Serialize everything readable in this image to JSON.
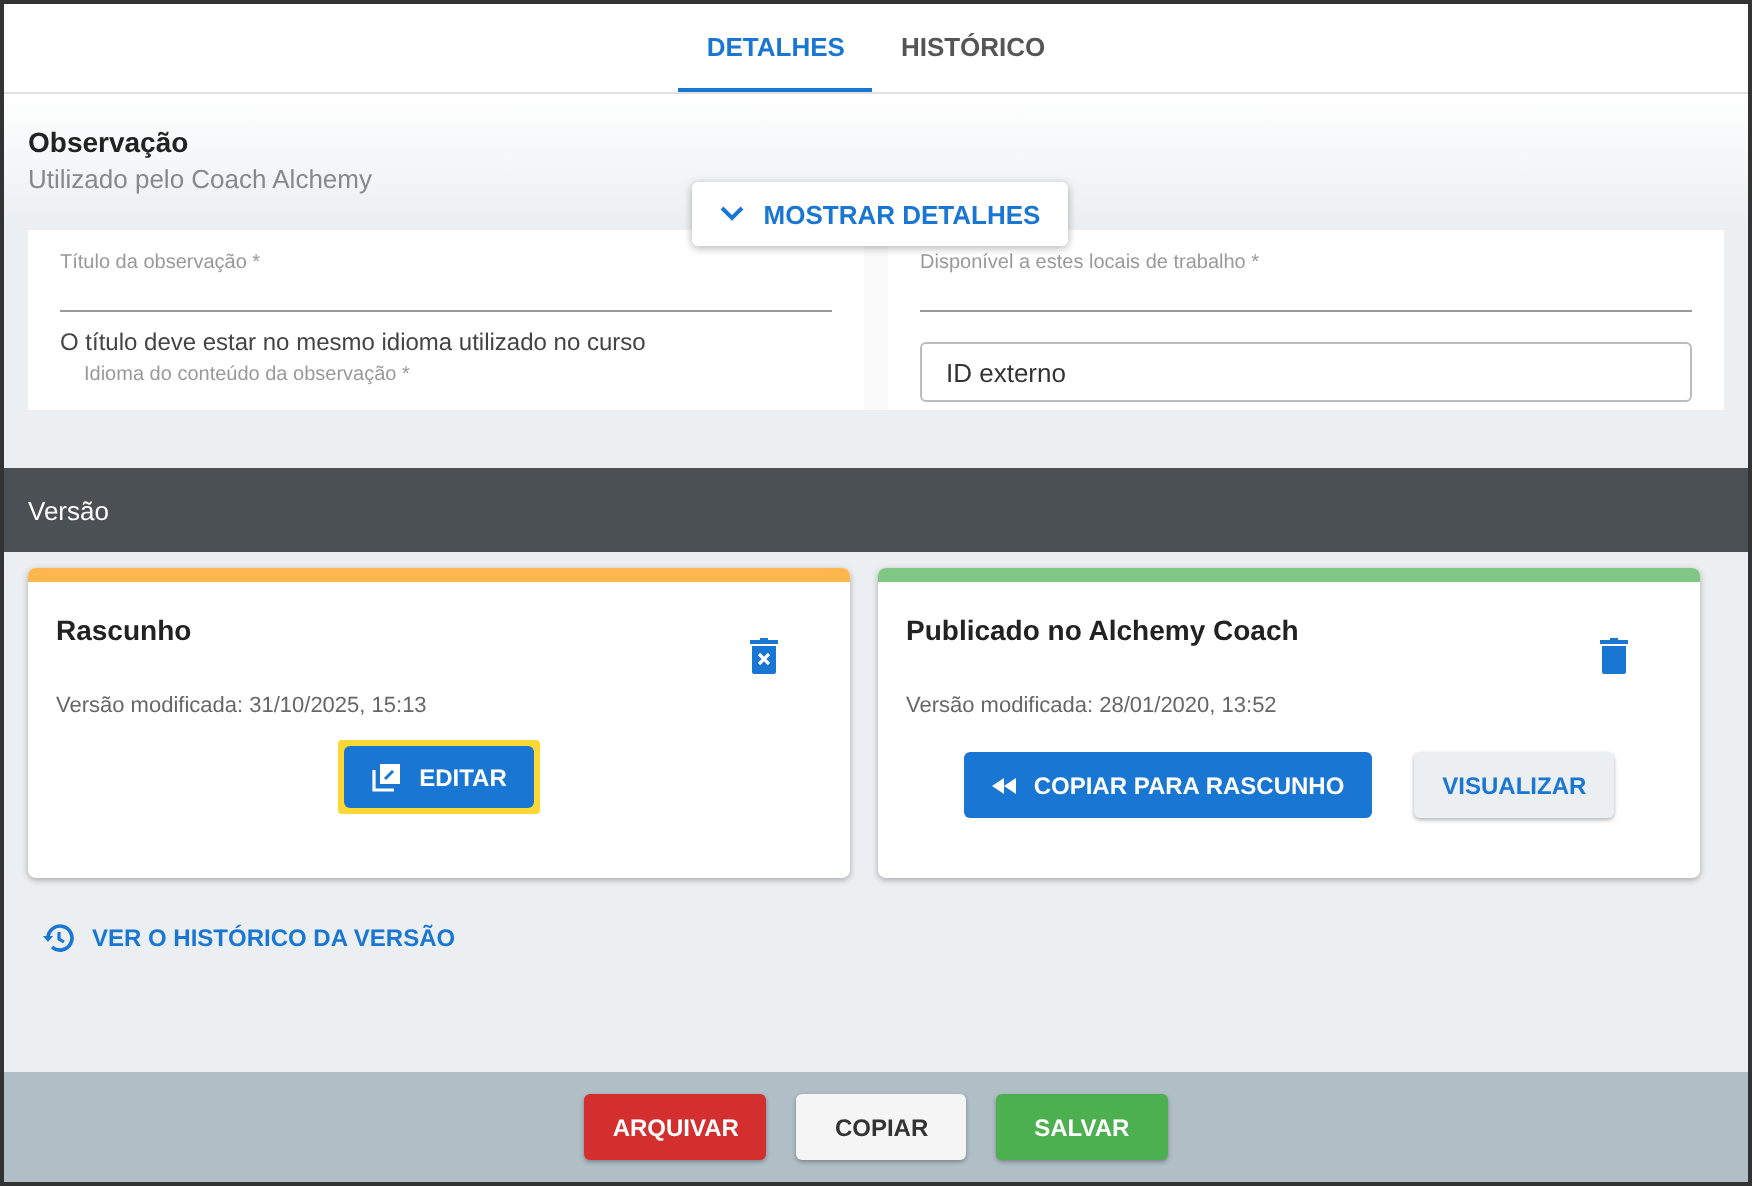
{
  "tabs": [
    {
      "label": "DETALHES",
      "selected": true
    },
    {
      "label": "HISTÓRICO",
      "selected": false
    }
  ],
  "observation": {
    "title": "Observação",
    "subtitle": "Utilizado pelo Coach Alchemy",
    "toggle": "MOSTRAR DETALHES",
    "fields": [
      {
        "label": "Título da observação *",
        "helper": "O título deve estar no mesmo idioma utilizado no curso",
        "next_label": "Idioma do conteúdo da observação *"
      },
      {
        "label": "Disponível a estes locais de trabalho *",
        "outlined_placeholder": "ID externo"
      }
    ]
  },
  "version": {
    "title": "Versão",
    "cards": [
      {
        "kind": "draft",
        "color": "#ffb74d",
        "title": "Rascunho",
        "modified": "Versão modificada: 31/10/2025, 15:13",
        "buttons": [
          {
            "kind": "edit",
            "label": "EDITAR",
            "highlighted": true
          }
        ]
      },
      {
        "kind": "published",
        "color": "#81c784",
        "title": "Publicado no Alchemy Coach",
        "modified": "Versão modificada: 28/01/2020, 13:52",
        "buttons": [
          {
            "kind": "copy",
            "label": "COPIAR PARA RASCUNHO",
            "highlighted": false
          },
          {
            "kind": "view",
            "label": "VISUALIZAR",
            "highlighted": false
          }
        ]
      }
    ],
    "history_link": "VER O HISTÓRICO DA VERSÃO"
  },
  "footer_buttons": [
    {
      "kind": "danger",
      "label": "ARQUIVAR"
    },
    {
      "kind": "plain",
      "label": "COPIAR"
    },
    {
      "kind": "success",
      "label": "SALVAR"
    }
  ]
}
